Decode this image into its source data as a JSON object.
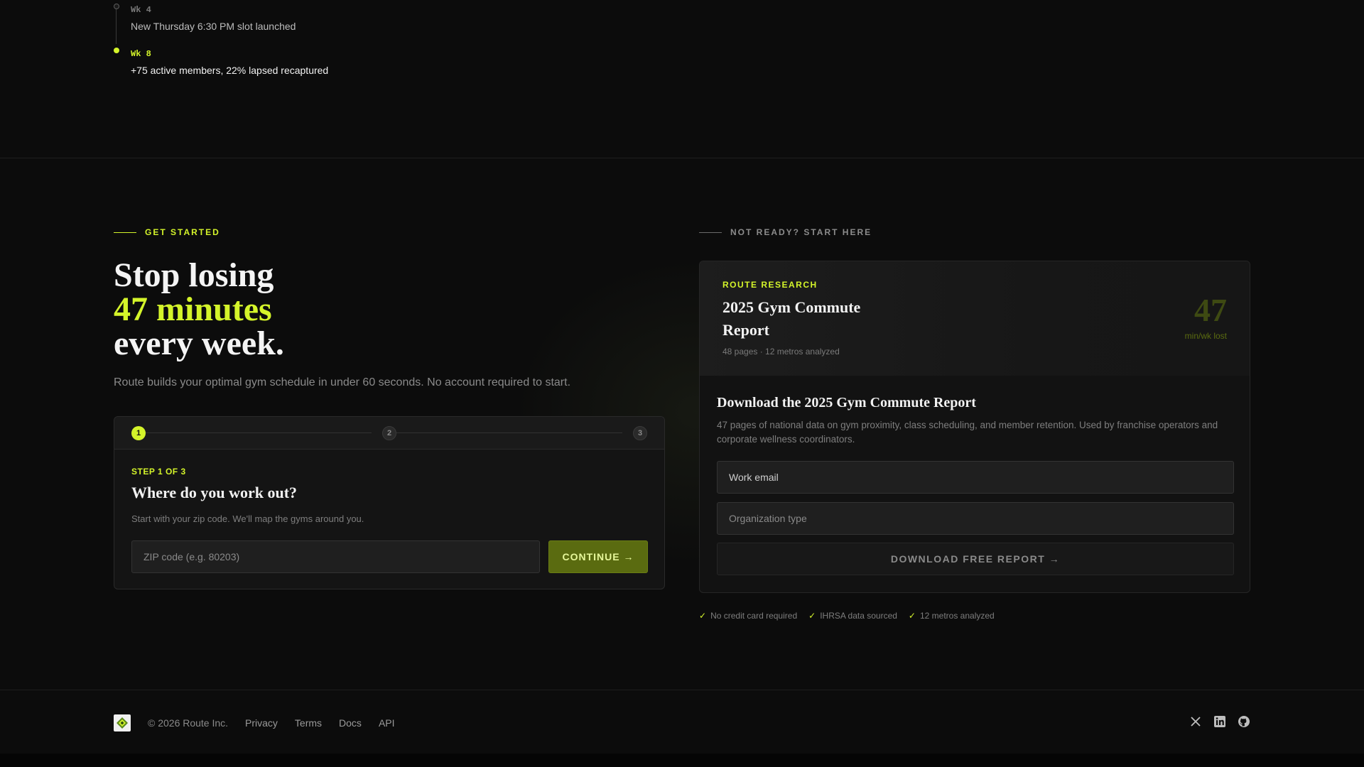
{
  "timeline": {
    "items": [
      {
        "week": "Wk 4",
        "text": "New Thursday 6:30 PM slot launched",
        "state": "muted"
      },
      {
        "week": "Wk 8",
        "text": "+75 active members, 22% lapsed recaptured",
        "state": "active"
      }
    ]
  },
  "get_started": {
    "eyebrow": "GET STARTED",
    "headline_line1": "Stop losing",
    "headline_highlight": "47 minutes",
    "headline_line3": "every week.",
    "subtext": "Route builds your optimal gym schedule in under 60 seconds. No account required to start.",
    "wizard": {
      "steps": [
        "1",
        "2",
        "3"
      ],
      "current_step": 1,
      "step_label": "STEP 1 OF 3",
      "title": "Where do you work out?",
      "description": "Start with your zip code. We'll map the gyms around you.",
      "zip_placeholder": "ZIP code (e.g. 80203)",
      "continue_label": "CONTINUE →"
    }
  },
  "report": {
    "eyebrow": "NOT READY? START HERE",
    "hero": {
      "label": "ROUTE RESEARCH",
      "title": "2025 Gym Commute Report",
      "meta": "48 pages · 12 metros analyzed",
      "stat_value": "47",
      "stat_label": "min/wk lost"
    },
    "title": "Download the 2025 Gym Commute Report",
    "description": "47 pages of national data on gym proximity, class scheduling, and member retention. Used by franchise operators and corporate wellness coordinators.",
    "email_placeholder": "Work email",
    "org_placeholder": "Organization type",
    "download_label": "DOWNLOAD FREE REPORT →",
    "badges": [
      "No credit card required",
      "IHRSA data sourced",
      "12 metros analyzed"
    ]
  },
  "footer": {
    "copyright": "© 2026 Route Inc.",
    "links": [
      "Privacy",
      "Terms",
      "Docs",
      "API"
    ],
    "social_icons": [
      "x-icon",
      "linkedin-icon",
      "github-icon"
    ]
  },
  "colors": {
    "accent": "#d4f42a",
    "background": "#0c0c0c",
    "button_olive": "#5a6b10"
  }
}
